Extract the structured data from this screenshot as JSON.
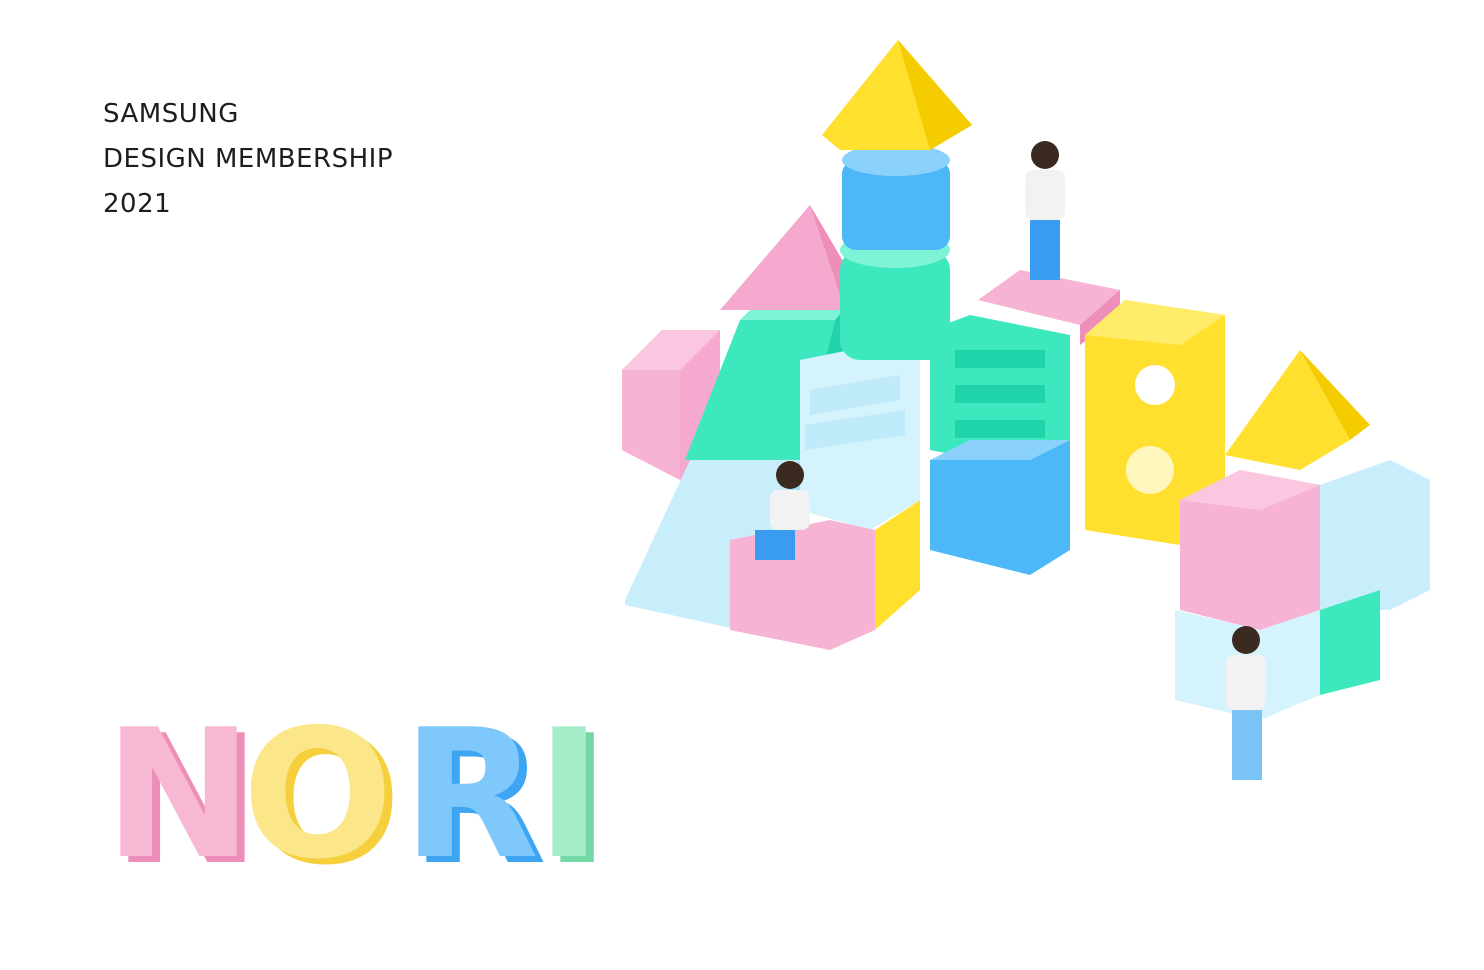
{
  "header": {
    "line1": "SAMSUNG",
    "line2": "DESIGN MEMBERSHIP",
    "line3": "2021"
  },
  "logo": {
    "letters": [
      {
        "char": "N",
        "color": "#f7b8d3",
        "shade": "#ee8fb9"
      },
      {
        "char": "O",
        "color": "#fbe68a",
        "shade": "#f6cf3c"
      },
      {
        "char": "R",
        "color": "#7ec8fb",
        "shade": "#3ea5f3"
      },
      {
        "char": "I",
        "color": "#a8edc9",
        "shade": "#74d7a6"
      }
    ]
  },
  "colors": {
    "pink": "#f7b3d4",
    "yellow": "#ffe02e",
    "mint": "#3de8bf",
    "blue": "#4db8f7",
    "light-blue": "#c9eefb"
  }
}
